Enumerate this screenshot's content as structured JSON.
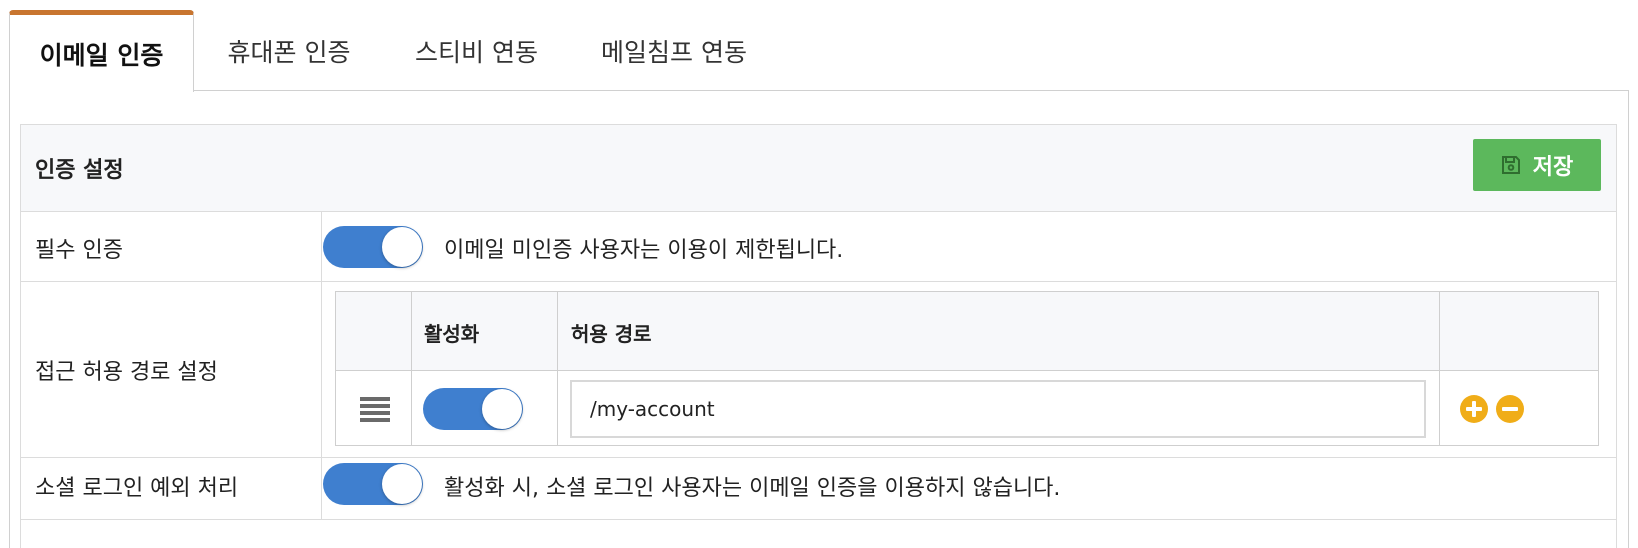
{
  "tabs": [
    {
      "label": "이메일 인증",
      "active": true
    },
    {
      "label": "휴대폰 인증",
      "active": false
    },
    {
      "label": "스티비 연동",
      "active": false
    },
    {
      "label": "메일침프 연동",
      "active": false
    }
  ],
  "card": {
    "title": "인증 설정",
    "save_label": "저장",
    "save_icon": "floppy-disk-icon"
  },
  "rows": {
    "required": {
      "label": "필수 인증",
      "enabled": true,
      "description": "이메일 미인증 사용자는 이용이 제한됩니다."
    },
    "paths": {
      "label": "접근 허용 경로 설정",
      "columns": [
        "",
        "활성화",
        "허용 경로",
        ""
      ],
      "items": [
        {
          "enabled": true,
          "path": "/my-account"
        }
      ]
    },
    "social": {
      "label": "소셜 로그인 예외 처리",
      "enabled": true,
      "description": "활성화 시, 소셜 로그인 사용자는 이메일 인증을 이용하지 않습니다."
    }
  },
  "colors": {
    "tab_accent": "#c8752f",
    "save_button": "#5cb85c",
    "toggle_on": "#3f7fcf",
    "action_button": "#f0ad18"
  }
}
